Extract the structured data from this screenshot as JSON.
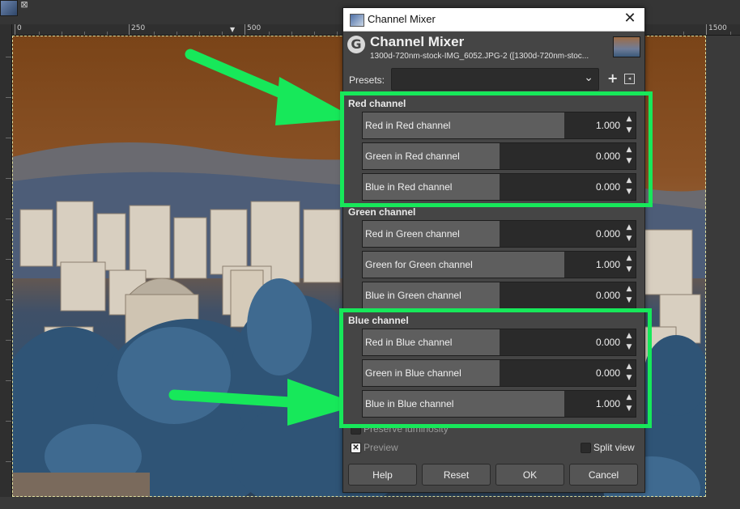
{
  "ruler": {
    "ticks": [
      "0",
      "250",
      "500",
      "1500"
    ]
  },
  "dialog": {
    "window_title": "Channel Mixer",
    "header_title": "Channel Mixer",
    "header_subtitle": "1300d-720nm-stock-IMG_6052.JPG-2 ([1300d-720nm-stoc...",
    "close_glyph": "✕",
    "presets_label": "Presets:",
    "presets_value": "",
    "plus_glyph": "+",
    "red": {
      "title": "Red channel",
      "rows": [
        {
          "label": "Red in Red channel",
          "value": "1.000",
          "fraction": 0.74
        },
        {
          "label": "Green in Red channel",
          "value": "0.000",
          "fraction": 0.5
        },
        {
          "label": "Blue in Red channel",
          "value": "0.000",
          "fraction": 0.5
        }
      ]
    },
    "green": {
      "title": "Green channel",
      "rows": [
        {
          "label": "Red in Green channel",
          "value": "0.000",
          "fraction": 0.5
        },
        {
          "label": "Green for Green channel",
          "value": "1.000",
          "fraction": 0.74
        },
        {
          "label": "Blue in Green channel",
          "value": "0.000",
          "fraction": 0.5
        }
      ]
    },
    "blue": {
      "title": "Blue channel",
      "rows": [
        {
          "label": "Red in Blue channel",
          "value": "0.000",
          "fraction": 0.5
        },
        {
          "label": "Green in Blue channel",
          "value": "0.000",
          "fraction": 0.5
        },
        {
          "label": "Blue in Blue channel",
          "value": "1.000",
          "fraction": 0.74
        }
      ]
    },
    "preserve_luminosity": {
      "label": "Preserve luminosity",
      "checked": false
    },
    "preview": {
      "label": "Preview",
      "checked": true
    },
    "split_view": {
      "label": "Split view",
      "checked": false
    },
    "buttons": {
      "help": "Help",
      "reset": "Reset",
      "ok": "OK",
      "cancel": "Cancel"
    }
  },
  "colors": {
    "highlight": "#17e85a",
    "dialog_bg": "#454545",
    "spin_fill": "#5e5e5e"
  }
}
